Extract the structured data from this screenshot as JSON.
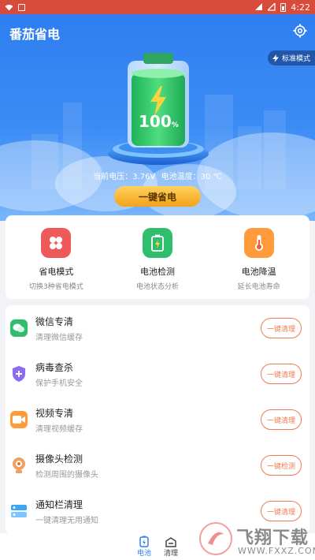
{
  "status": {
    "time": "4:22"
  },
  "header": {
    "title": "番茄省电",
    "mode_chip": "标准模式"
  },
  "battery": {
    "percent_value": "100",
    "percent_sign": "%",
    "voltage_label": "当前电压：",
    "voltage_value": "3.76V",
    "temp_label": "电池温度：",
    "temp_value": "30 ℃",
    "action_label": "一键省电"
  },
  "features": [
    {
      "title": "省电模式",
      "sub": "切换3种省电模式",
      "icon": "power-mode-icon",
      "color": "#ee5a5a"
    },
    {
      "title": "电池检测",
      "sub": "电池状态分析",
      "icon": "battery-check-icon",
      "color": "#2fbe6e"
    },
    {
      "title": "电池降温",
      "sub": "延长电池寿命",
      "icon": "thermometer-icon",
      "color": "#ff9b3b"
    }
  ],
  "list": [
    {
      "title": "微信专清",
      "sub": "清理微信缓存",
      "button": "一键清理",
      "icon": "wechat-icon",
      "color": "#2fbe6e"
    },
    {
      "title": "病毒查杀",
      "sub": "保护手机安全",
      "button": "一键清理",
      "icon": "shield-icon",
      "color": "#8a6cf0"
    },
    {
      "title": "视频专清",
      "sub": "清理视频缓存",
      "button": "一键清理",
      "icon": "video-icon",
      "color": "#ff9b3b"
    },
    {
      "title": "摄像头检测",
      "sub": "检测周围的摄像头",
      "button": "一键检测",
      "icon": "camera-icon",
      "color": "#f0a060"
    },
    {
      "title": "通知栏清理",
      "sub": "一键清理无用通知",
      "button": "一键清理",
      "icon": "notification-icon",
      "color": "#3aa6f5"
    }
  ],
  "nav": [
    {
      "label": "电池",
      "icon": "battery-nav-icon"
    },
    {
      "label": "清理",
      "icon": "clean-nav-icon"
    }
  ],
  "watermark": {
    "brand": "飞翔下载",
    "url": "WWW.FXXZ.COM"
  },
  "colors": {
    "primary": "#2f7ef0",
    "accent_orange": "#f07a50",
    "button_gold": "#f4a21a"
  }
}
